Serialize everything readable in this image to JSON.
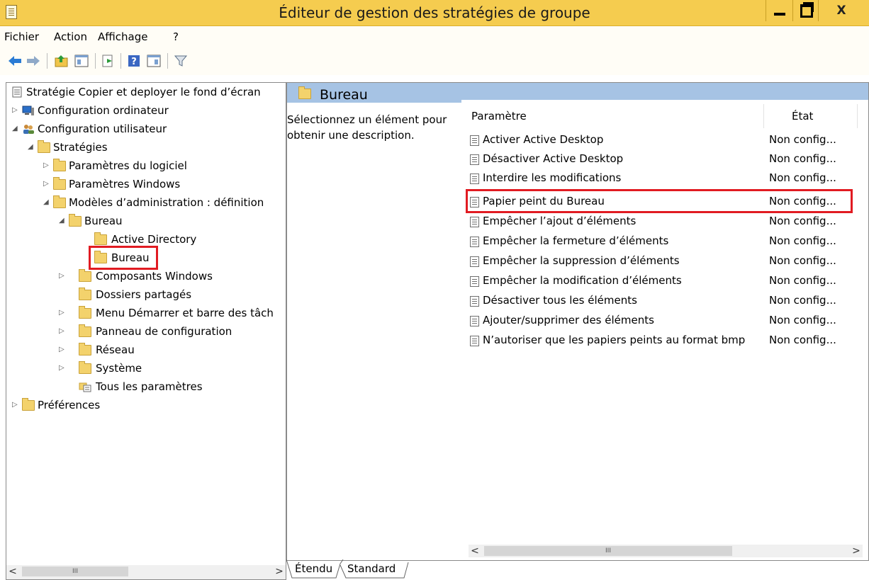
{
  "window": {
    "title": "Éditeur de gestion des stratégies de groupe",
    "controls": {
      "minimize": "_",
      "maximize": "□",
      "close": "X"
    }
  },
  "menu": [
    "Fichier",
    "Action",
    "Affichage",
    "?"
  ],
  "toolbar_icons": [
    "back-arrow-icon",
    "forward-arrow-icon",
    "folder-up-icon",
    "show-hide-tree-icon",
    "export-list-icon",
    "help-icon",
    "properties-icon",
    "filter-icon"
  ],
  "tree": {
    "root": "Stratégie Copier et deployer le fond d’écran",
    "items": [
      {
        "label": "Configuration ordinateur",
        "expander": "▷"
      },
      {
        "label": "Configuration utilisateur",
        "expander": "◢"
      },
      {
        "label": "Stratégies",
        "expander": "◢"
      },
      {
        "label": "Paramètres du logiciel",
        "expander": "▷"
      },
      {
        "label": "Paramètres Windows",
        "expander": "▷"
      },
      {
        "label": "Modèles d’administration : définition",
        "expander": "◢"
      },
      {
        "label": "Bureau",
        "expander": "◢"
      },
      {
        "label": "Active Directory",
        "expander": ""
      },
      {
        "label": "Bureau",
        "expander": ""
      },
      {
        "label": "Composants Windows",
        "expander": "▷"
      },
      {
        "label": "Dossiers partagés",
        "expander": ""
      },
      {
        "label": "Menu Démarrer et barre des tâch",
        "expander": "▷"
      },
      {
        "label": "Panneau de configuration",
        "expander": "▷"
      },
      {
        "label": "Réseau",
        "expander": "▷"
      },
      {
        "label": "Système",
        "expander": "▷"
      },
      {
        "label": "Tous les paramètres",
        "expander": ""
      },
      {
        "label": "Préférences",
        "expander": "▷"
      }
    ]
  },
  "right": {
    "title": "Bureau",
    "description": "Sélectionnez un élément pour obtenir une description.",
    "columns": {
      "setting": "Paramètre",
      "state": "État"
    },
    "rows": [
      {
        "name": "Activer Active Desktop",
        "state": "Non config..."
      },
      {
        "name": "Désactiver Active Desktop",
        "state": "Non config..."
      },
      {
        "name": "Interdire les modifications",
        "state": "Non config..."
      },
      {
        "name": "Papier peint du Bureau",
        "state": "Non config..."
      },
      {
        "name": "Empêcher l’ajout d’éléments",
        "state": "Non config..."
      },
      {
        "name": "Empêcher la fermeture d’éléments",
        "state": "Non config..."
      },
      {
        "name": "Empêcher la suppression d’éléments",
        "state": "Non config..."
      },
      {
        "name": "Empêcher la modification d’éléments",
        "state": "Non config..."
      },
      {
        "name": "Désactiver tous les éléments",
        "state": "Non config..."
      },
      {
        "name": "Ajouter/supprimer des éléments",
        "state": "Non config..."
      },
      {
        "name": "N’autoriser que les papiers peints au format bmp",
        "state": "Non config..."
      }
    ]
  },
  "tabs": [
    "Étendu",
    "Standard"
  ],
  "scroll": {
    "left_btn": "<",
    "right_btn": ">",
    "thumb": "III"
  },
  "colors": {
    "titlebar": "#f5cc4f",
    "header": "#a6c3e4",
    "highlight": "#e11b22"
  }
}
